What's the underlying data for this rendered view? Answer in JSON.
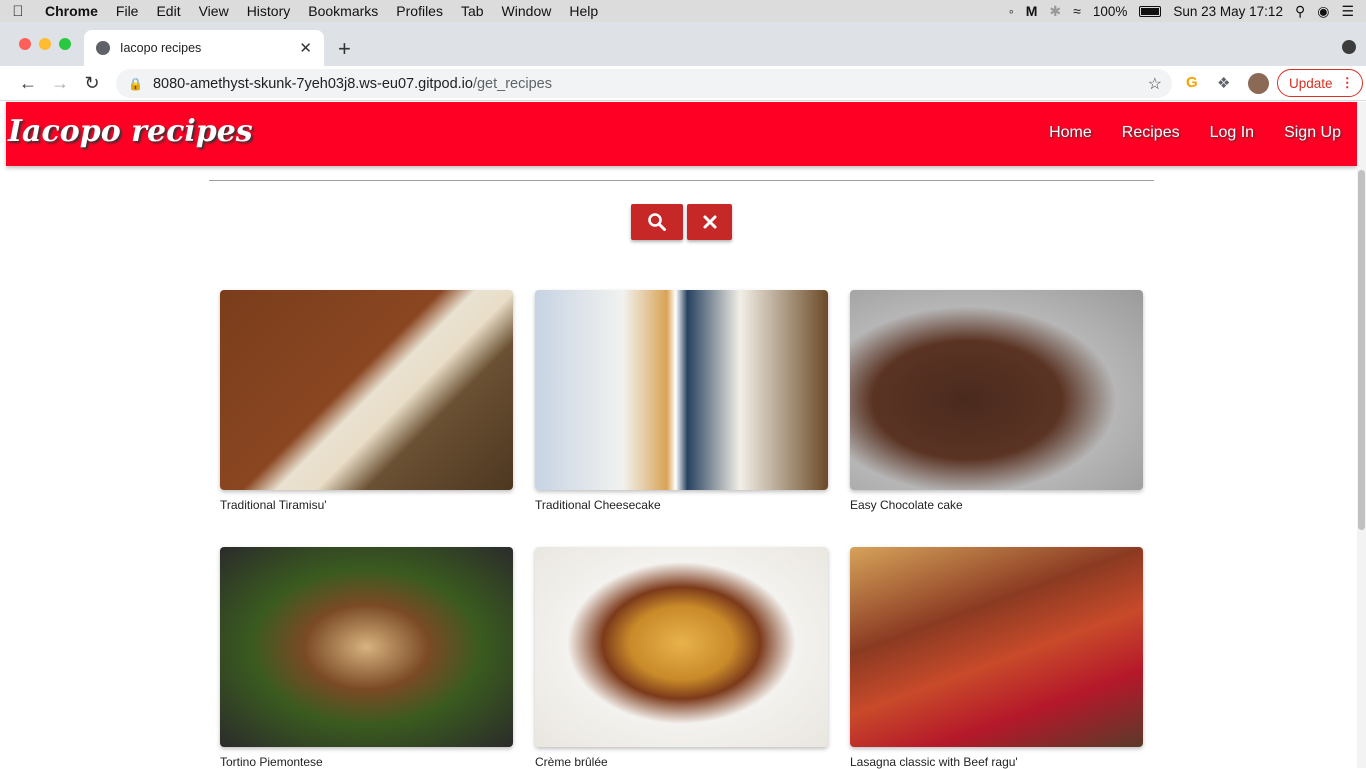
{
  "menubar": {
    "app": "Chrome",
    "items": [
      "File",
      "Edit",
      "View",
      "History",
      "Bookmarks",
      "Profiles",
      "Tab",
      "Window",
      "Help"
    ],
    "battery": "100%",
    "datetime": "Sun 23 May  17:12"
  },
  "browser": {
    "tab_title": "Iacopo recipes",
    "url_host": "8080-amethyst-skunk-7yeh03j8.ws-eu07.gitpod.io",
    "url_path": "/get_recipes",
    "update_label": "Update"
  },
  "site": {
    "brand": "Iacopo recipes",
    "nav": [
      "Home",
      "Recipes",
      "Log In",
      "Sign Up"
    ],
    "accent": "#ff0025",
    "button_color": "#c62828"
  },
  "recipes": [
    {
      "title": "Traditional Tiramisu'",
      "image": "tiramisu"
    },
    {
      "title": "Traditional Cheesecake",
      "image": "cheesecake"
    },
    {
      "title": "Easy Chocolate cake",
      "image": "chocolate-cake"
    },
    {
      "title": "Tortino Piemontese",
      "image": "tortino"
    },
    {
      "title": "Crème brûlée",
      "image": "creme-brulee"
    },
    {
      "title": "Lasagna classic with Beef ragu'",
      "image": "lasagna"
    }
  ]
}
